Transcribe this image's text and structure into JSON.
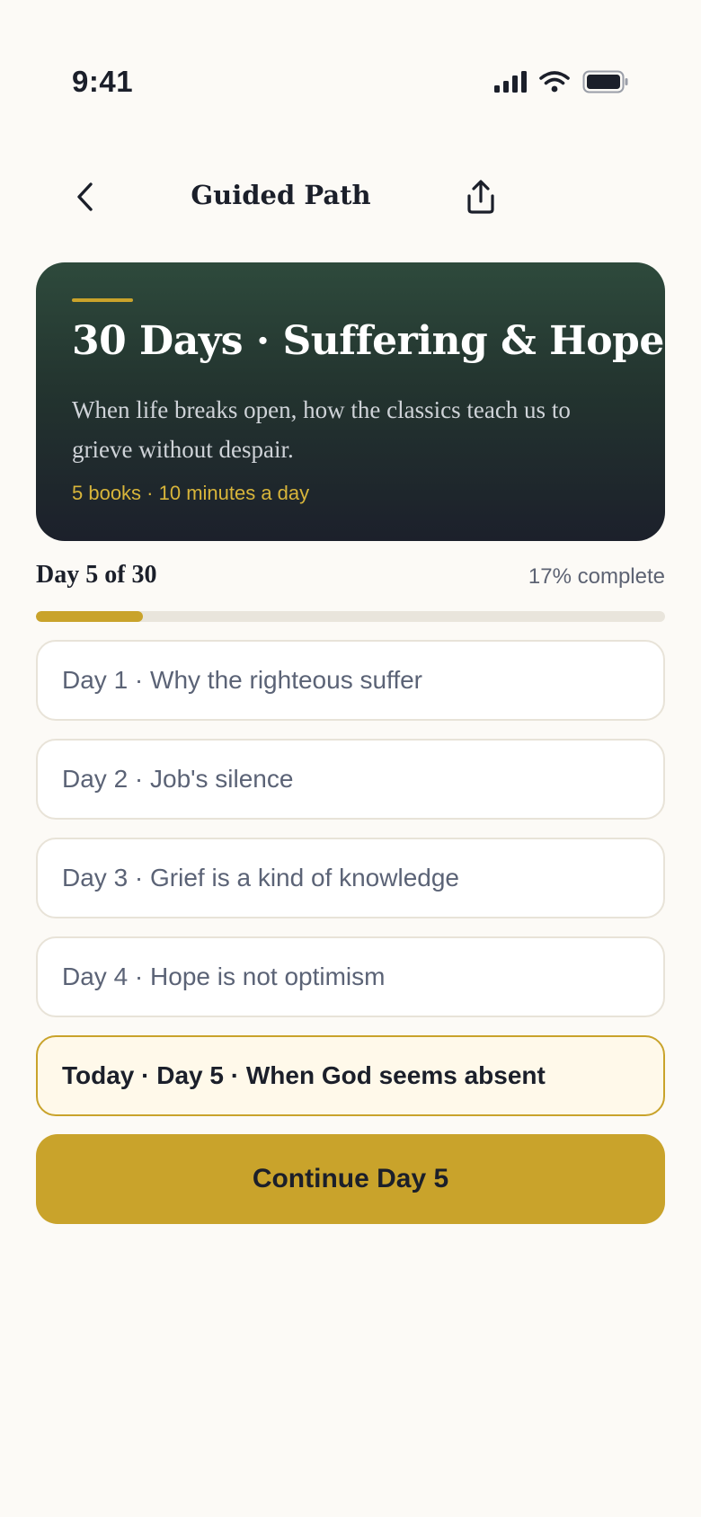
{
  "status_bar": {
    "time": "9:41"
  },
  "nav": {
    "title": "Guided Path",
    "back_icon": "chevron-left-icon",
    "share_icon": "share-icon"
  },
  "hero": {
    "title": "30 Days · Suffering & Hope",
    "description": "When life breaks open, how the classics teach us to grieve without despair.",
    "meta": "5 books · 10 minutes a day"
  },
  "progress": {
    "label": "Day 5 of 30",
    "percent_label": "17% complete",
    "fraction": 0.17
  },
  "days": [
    {
      "label": "Day 1 · Why the righteous suffer",
      "today": false
    },
    {
      "label": "Day 2 · Job's silence",
      "today": false
    },
    {
      "label": "Day 3 · Grief is a kind of knowledge",
      "today": false
    },
    {
      "label": "Day 4 · Hope is not optimism",
      "today": false
    },
    {
      "label": "Today · Day 5 · When God seems absent",
      "today": true
    }
  ],
  "cta": {
    "label": "Continue Day 5"
  },
  "colors": {
    "accent": "#c9a32b",
    "background": "#fcfaf6",
    "hero_top": "#2e4a3c",
    "hero_bottom": "#1c202b",
    "today_bg": "#fff9ea"
  }
}
